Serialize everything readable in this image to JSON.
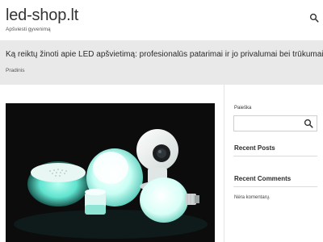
{
  "header": {
    "site_title": "led-shop.lt",
    "tagline": "Apšviesti gyvenimą",
    "search_icon": "search-icon"
  },
  "hero": {
    "title": "Ką reiktų žinoti apie LED apšvietimą: profesionalūs patarimai ir jo privalumai bei trūkumai",
    "breadcrumb": "Pradinis"
  },
  "sidebar": {
    "search": {
      "label": "Paieška",
      "placeholder": "",
      "icon": "search-icon"
    },
    "recent_posts": {
      "title": "Recent Posts"
    },
    "recent_comments": {
      "title": "Recent Comments",
      "empty_text": "Nėra komentarų."
    }
  },
  "colors": {
    "hero_bg": "#e9e9ea",
    "image_bg": "#0c0c0d",
    "glow": "#7ff2e0"
  }
}
